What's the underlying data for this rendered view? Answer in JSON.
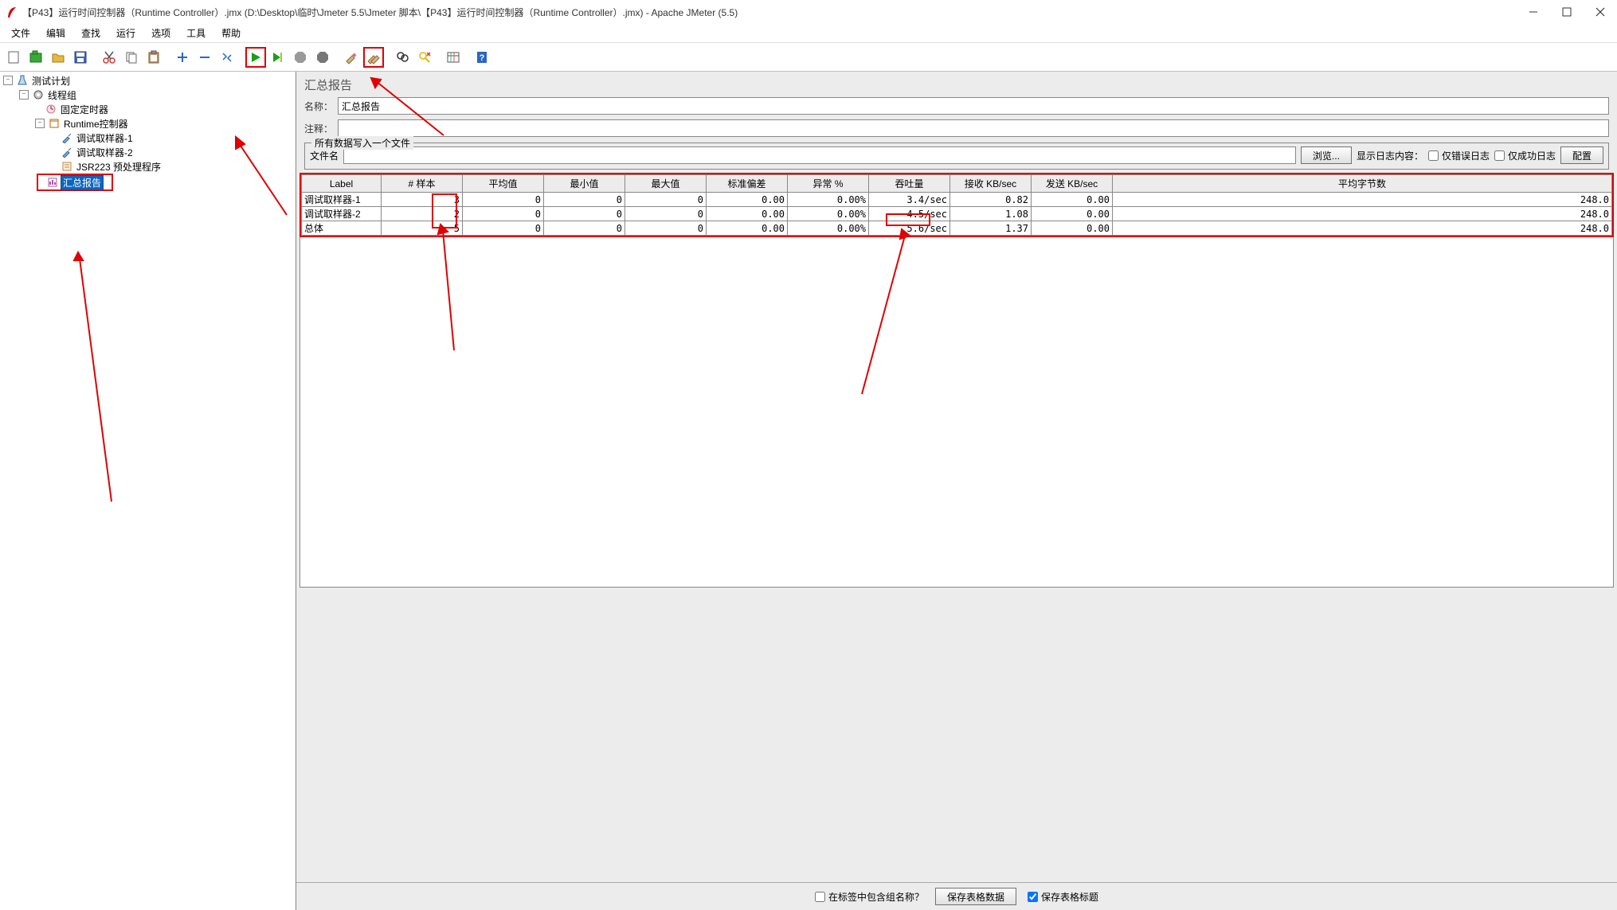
{
  "window": {
    "title": "【P43】运行时间控制器（Runtime Controller）.jmx (D:\\Desktop\\临时\\Jmeter 5.5\\Jmeter 脚本\\【P43】运行时间控制器（Runtime Controller）.jmx) - Apache JMeter (5.5)"
  },
  "menubar": {
    "items": [
      "文件",
      "编辑",
      "查找",
      "运行",
      "选项",
      "工具",
      "帮助"
    ]
  },
  "toolbar": {
    "icons": [
      "new-icon",
      "templates-icon",
      "open-icon",
      "save-icon",
      "",
      "cut-icon",
      "copy-icon",
      "paste-icon",
      "",
      "expand-icon",
      "collapse-icon",
      "toggle-icon",
      "",
      "start-icon",
      "start-no-timers-icon",
      "stop-icon",
      "shutdown-icon",
      "",
      "clear-icon",
      "clear-all-icon",
      "",
      "search-icon",
      "reset-search-icon",
      "",
      "function-helper-icon",
      "",
      "help-icon"
    ]
  },
  "tree": {
    "root": "测试计划",
    "thread_group": "线程组",
    "fixed_timer": "固定定时器",
    "runtime_controller": "Runtime控制器",
    "debug1": "调试取样器-1",
    "debug2": "调试取样器-2",
    "jsr223": "JSR223 预处理程序",
    "summary": "汇总报告"
  },
  "panel": {
    "title": "汇总报告",
    "name_label": "名称：",
    "name_value": "汇总报告",
    "comment_label": "注释：",
    "comment_value": "",
    "file_legend": "所有数据写入一个文件",
    "filename_label": "文件名",
    "filename_value": "",
    "browse": "浏览...",
    "log_display": "显示日志内容：",
    "errors_only": "仅错误日志",
    "success_only": "仅成功日志",
    "configure": "配置"
  },
  "table": {
    "headers": [
      "Label",
      "# 样本",
      "平均值",
      "最小值",
      "最大值",
      "标准偏差",
      "异常 %",
      "吞吐量",
      "接收 KB/sec",
      "发送 KB/sec",
      "平均字节数"
    ],
    "rows": [
      {
        "label": "调试取样器-1",
        "samples": "3",
        "avg": "0",
        "min": "0",
        "max": "0",
        "std": "0.00",
        "err": "0.00%",
        "thr": "3.4/sec",
        "recv": "0.82",
        "send": "0.00",
        "bytes": "248.0"
      },
      {
        "label": "调试取样器-2",
        "samples": "2",
        "avg": "0",
        "min": "0",
        "max": "0",
        "std": "0.00",
        "err": "0.00%",
        "thr": "4.5/sec",
        "recv": "1.08",
        "send": "0.00",
        "bytes": "248.0"
      },
      {
        "label": "总体",
        "samples": "5",
        "avg": "0",
        "min": "0",
        "max": "0",
        "std": "0.00",
        "err": "0.00%",
        "thr": "5.6/sec",
        "recv": "1.37",
        "send": "0.00",
        "bytes": "248.0"
      }
    ]
  },
  "bottom": {
    "include_group": "在标签中包含组名称？",
    "save_table_data": "保存表格数据",
    "save_table_header": "保存表格标题"
  }
}
